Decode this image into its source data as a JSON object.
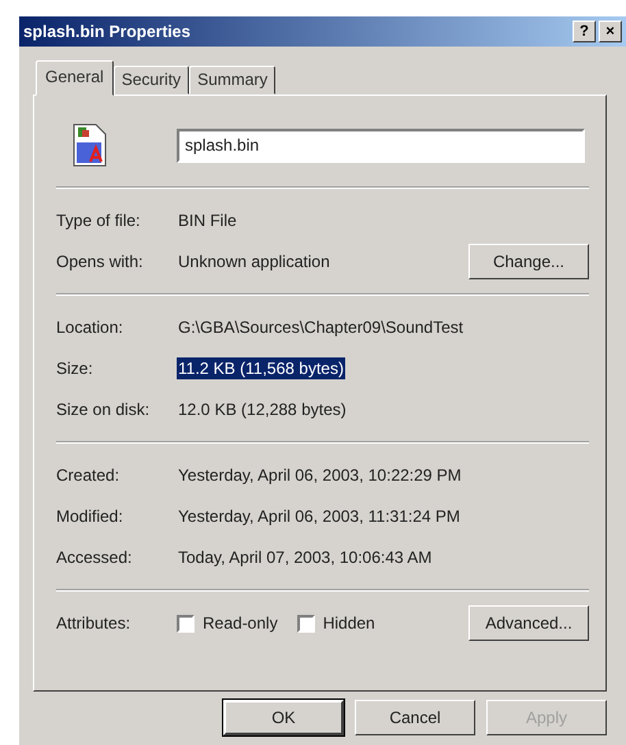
{
  "window": {
    "title": "splash.bin Properties",
    "title_buttons": [
      "?",
      "×"
    ]
  },
  "tabs": [
    {
      "label": "General",
      "selected": true
    },
    {
      "label": "Security",
      "selected": false
    },
    {
      "label": "Summary",
      "selected": false
    }
  ],
  "file_name": "splash.bin",
  "groups": [
    [
      {
        "label": "Type of file:",
        "value": "BIN File",
        "selected": false
      },
      {
        "label": "Opens with:",
        "value": "Unknown application",
        "selected": false,
        "button": "Change..."
      }
    ],
    [
      {
        "label": "Location:",
        "value": "G:\\GBA\\Sources\\Chapter09\\SoundTest",
        "selected": false
      },
      {
        "label": "Size:",
        "value": "11.2 KB (11,568 bytes)",
        "selected": true
      },
      {
        "label": "Size on disk:",
        "value": "12.0 KB (12,288 bytes)",
        "selected": false
      }
    ],
    [
      {
        "label": "Created:",
        "value": "Yesterday, April 06, 2003, 10:22:29 PM",
        "selected": false
      },
      {
        "label": "Modified:",
        "value": "Yesterday, April 06, 2003, 11:31:24 PM",
        "selected": false
      },
      {
        "label": "Accessed:",
        "value": "Today, April 07, 2003, 10:06:43 AM",
        "selected": false
      }
    ]
  ],
  "attributes": {
    "label": "Attributes:",
    "checkboxes": [
      {
        "label": "Read-only",
        "checked": false
      },
      {
        "label": "Hidden",
        "checked": false
      }
    ],
    "button": "Advanced..."
  },
  "buttons": [
    {
      "label": "OK",
      "default": true,
      "disabled": false
    },
    {
      "label": "Cancel",
      "default": false,
      "disabled": false
    },
    {
      "label": "Apply",
      "default": false,
      "disabled": true
    }
  ]
}
